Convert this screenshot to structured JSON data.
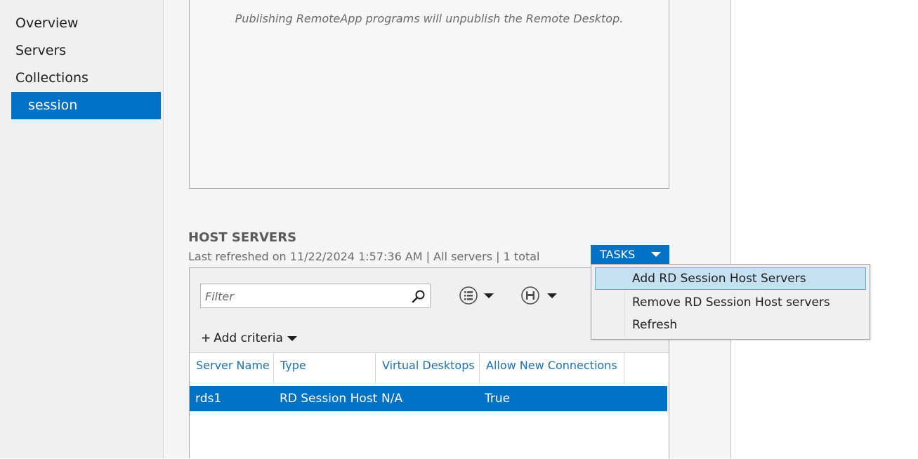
{
  "nav": {
    "items": [
      {
        "label": "Overview"
      },
      {
        "label": "Servers"
      },
      {
        "label": "Collections"
      },
      {
        "label": "session"
      }
    ]
  },
  "remoteapp": {
    "message": "Publishing RemoteApp programs will unpublish the Remote Desktop."
  },
  "host_servers": {
    "title": "HOST SERVERS",
    "last_refreshed": "Last refreshed on 11/22/2024 1:57:36 AM | All servers",
    "total": "| 1 total",
    "tasks_label": "TASKS",
    "filter_placeholder": "Filter",
    "add_criteria_label": "Add criteria",
    "columns": [
      "Server Name",
      "Type",
      "Virtual Desktops",
      "Allow New Connections"
    ],
    "rows": [
      {
        "server_name": "rds1",
        "type": "RD Session Host",
        "virtual_desktops": "N/A",
        "allow_new_connections": "True"
      }
    ]
  },
  "tasks_menu": {
    "items": [
      {
        "label": "Add RD Session Host Servers"
      },
      {
        "label": "Remove RD Session Host servers"
      },
      {
        "label": "Refresh"
      }
    ]
  },
  "colors": {
    "accent": "#0072c6",
    "header_text": "#1e6fb0",
    "menu_highlight": "#c5e0f0"
  }
}
